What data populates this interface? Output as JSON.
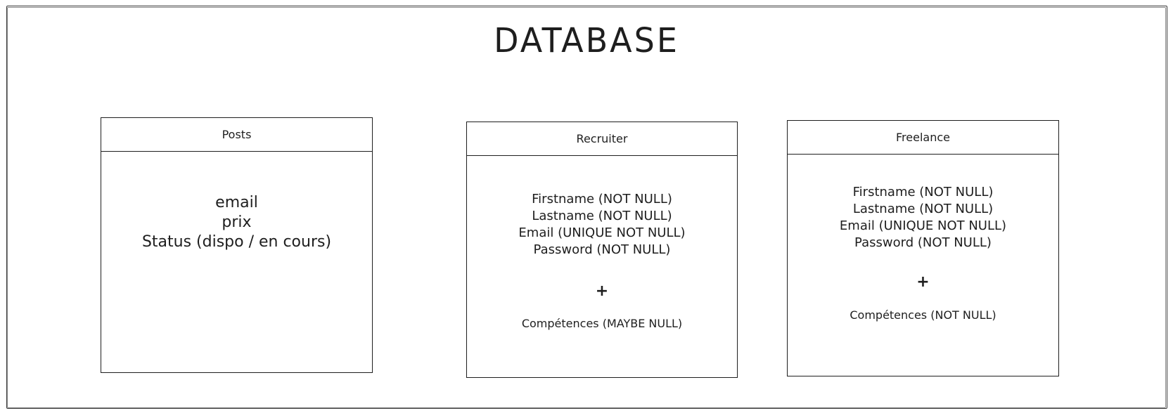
{
  "title": "DATABASE",
  "entities": [
    {
      "id": "posts",
      "header": "Posts",
      "fields": [
        "email",
        "prix",
        "Status (dispo / en cours)"
      ],
      "plus": "",
      "extra": ""
    },
    {
      "id": "recruiter",
      "header": "Recruiter",
      "fields": [
        "Firstname (NOT NULL)",
        "Lastname (NOT NULL)",
        "Email (UNIQUE NOT NULL)",
        "Password (NOT NULL)"
      ],
      "plus": "+",
      "extra": "Compétences (MAYBE NULL)"
    },
    {
      "id": "freelance",
      "header": "Freelance",
      "fields": [
        "Firstname (NOT NULL)",
        "Lastname (NOT NULL)",
        "Email (UNIQUE NOT NULL)",
        "Password (NOT NULL)"
      ],
      "plus": "+",
      "extra": "Compétences (NOT NULL)"
    }
  ]
}
